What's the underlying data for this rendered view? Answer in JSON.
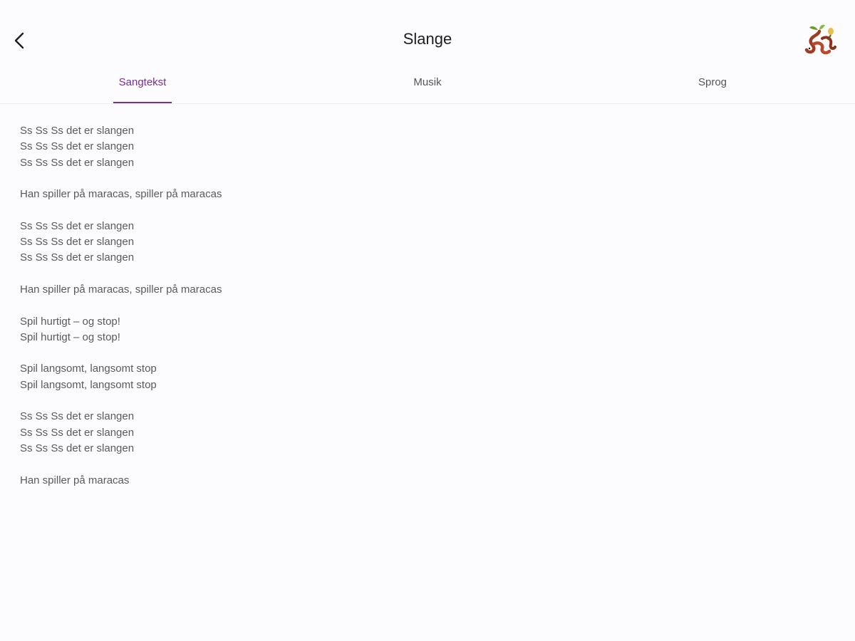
{
  "header": {
    "title": "Slange",
    "back_icon": "chevron-left-icon",
    "logo_icon": "snake-maracas-logo"
  },
  "tabs": [
    {
      "label": "Sangtekst",
      "active": true
    },
    {
      "label": "Musik",
      "active": false
    },
    {
      "label": "Sprog",
      "active": false
    }
  ],
  "colors": {
    "accent": "#7b2d93",
    "background": "#fcfbfe",
    "text": "#5a5a5a"
  },
  "lyrics": {
    "stanzas": [
      [
        "Ss Ss Ss det er slangen",
        "Ss Ss Ss det er slangen",
        "Ss Ss Ss det er slangen"
      ],
      [
        "Han spiller på maracas, spiller på maracas"
      ],
      [
        "Ss Ss Ss det er slangen",
        "Ss Ss Ss det er slangen",
        "Ss Ss Ss det er slangen"
      ],
      [
        "Han spiller på maracas, spiller på maracas"
      ],
      [
        "Spil hurtigt – og stop!",
        "Spil hurtigt – og stop!"
      ],
      [
        "Spil langsomt, langsomt stop",
        "Spil langsomt, langsomt stop"
      ],
      [
        "Ss Ss Ss det er slangen",
        "Ss Ss Ss det er slangen",
        "Ss Ss Ss det er slangen"
      ],
      [
        "Han spiller på maracas"
      ]
    ]
  }
}
